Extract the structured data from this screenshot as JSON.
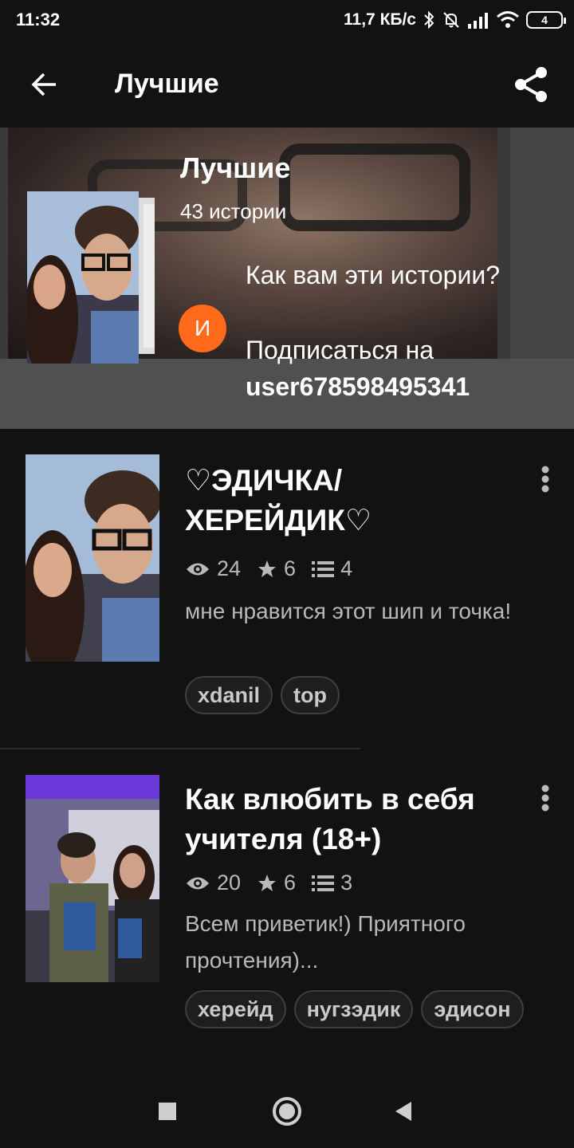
{
  "status_bar": {
    "time": "11:32",
    "speed": "11,7 КБ/с",
    "battery": "4"
  },
  "app_bar": {
    "title": "Лучшие"
  },
  "header": {
    "title": "Лучшие",
    "count": "43 истории",
    "avatar_letter": "И",
    "prompt": "Как вам эти истории?",
    "subscribe_prefix": "Подписаться на",
    "username": "user678598495341"
  },
  "stories": [
    {
      "title": "♡ЭДИЧКА/ХЕРЕЙДИК♡",
      "views": "24",
      "stars": "6",
      "parts": "4",
      "description": "мне нравится этот шип и точка!",
      "tags": [
        "xdanil",
        "top"
      ]
    },
    {
      "title": "Как влюбить в себя учителя (18+)",
      "views": "20",
      "stars": "6",
      "parts": "3",
      "description": "Всем приветик!) Приятного прочтения)...",
      "tags": [
        "херейд",
        "нугзэдик",
        "эдисон"
      ]
    }
  ],
  "colors": {
    "background": "#121212",
    "avatar": "#ff6b1a",
    "muted_text": "#b9b9b9"
  },
  "icons": [
    "back-arrow-icon",
    "share-icon",
    "eye-icon",
    "star-icon",
    "list-icon",
    "more-vert-icon",
    "square-icon",
    "circle-icon",
    "triangle-back-icon"
  ]
}
